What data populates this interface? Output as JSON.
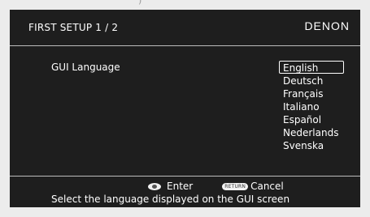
{
  "top_bezel_clipped_text": ")",
  "header": {
    "title": "FIRST SETUP 1 / 2",
    "brand": "DENON"
  },
  "setting": {
    "label": "GUI Language"
  },
  "languages": [
    "English",
    "Deutsch",
    "Français",
    "Italiano",
    "Español",
    "Nederlands",
    "Svenska"
  ],
  "selected_index": 0,
  "footer": {
    "enter_label": "Enter",
    "return_icon_text": "RETURN",
    "cancel_label": "Cancel",
    "help_text": "Select the language displayed on the GUI screen"
  },
  "colors": {
    "screen_background": "#1e1e1e",
    "text": "#ffffff",
    "page_background": "#ececec"
  },
  "icons": {
    "enter": "enter-button-icon",
    "return": "return-button-icon"
  }
}
